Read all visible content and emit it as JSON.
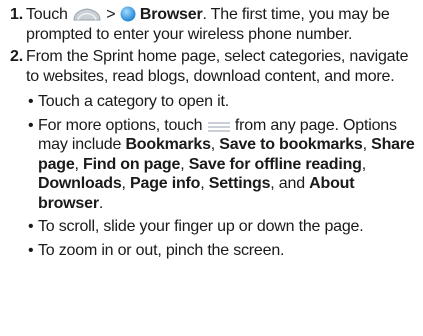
{
  "steps": [
    {
      "number": "1.",
      "part1": "Touch",
      "separator": ">",
      "browser_label": "Browser",
      "part2": ". The first time, you may be prompted to enter your wireless phone number."
    },
    {
      "number": "2.",
      "text": "From the Sprint home page, select categories, navigate to websites, read blogs, download content, and more.",
      "bullets": {
        "open_category": "Touch a category to open it.",
        "options_a": "For more options, touch",
        "options_b": "from any page. Options may include",
        "opt_bookmarks": "Bookmarks",
        "opt_save_bookmarks": "Save to bookmarks",
        "opt_share": "Share page",
        "opt_find": "Find on page",
        "opt_offline": "Save for offline reading",
        "opt_downloads": "Downloads",
        "opt_info": "Page info",
        "opt_settings": "Settings",
        "opt_about": "About browser",
        "and": "and",
        "scroll": "To scroll, slide your finger up or down the page.",
        "zoom": "To zoom in or out, pinch the screen."
      }
    }
  ],
  "icons": {
    "home": "home-icon",
    "browser": "browser-globe-icon",
    "menu": "menu-icon"
  },
  "colors": {
    "browser_icon": "#3aa0e4",
    "home_icon": "#a7afb6"
  }
}
